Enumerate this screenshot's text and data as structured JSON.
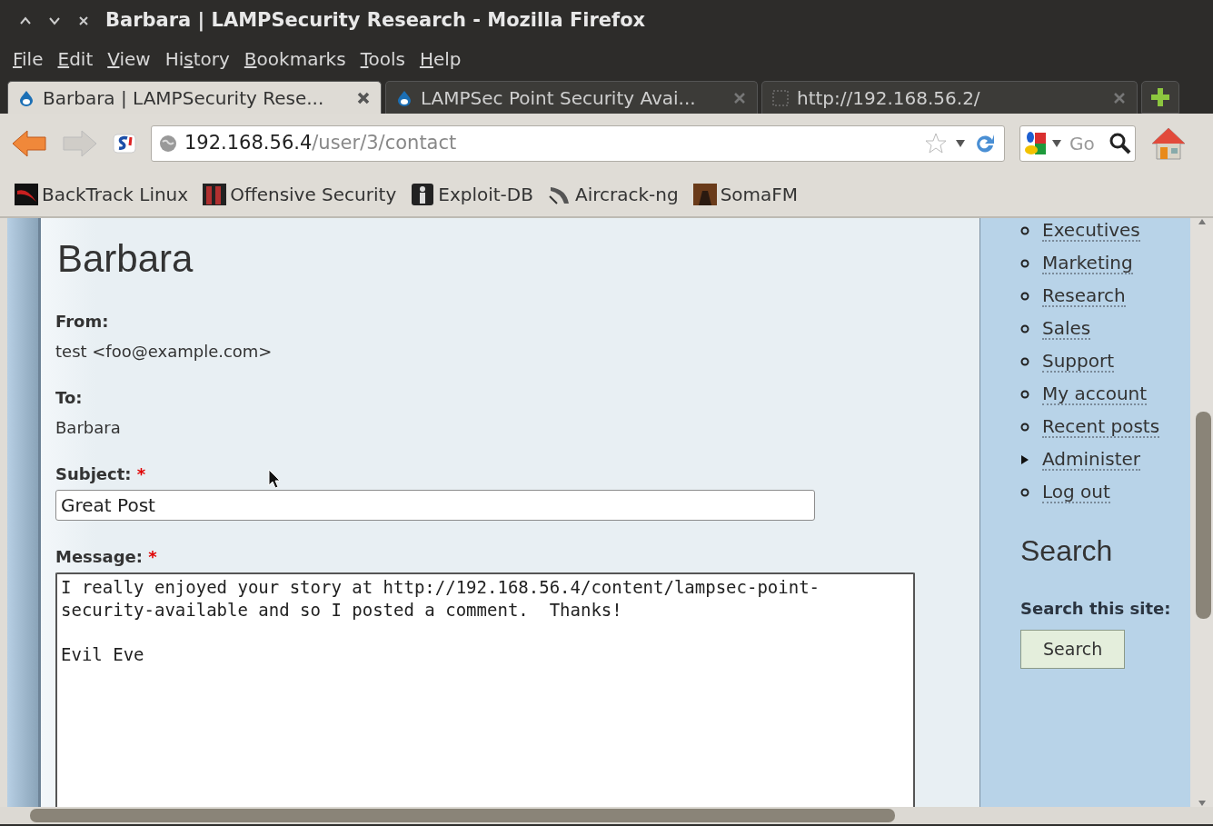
{
  "window": {
    "title": "Barbara | LAMPSecurity Research - Mozilla Firefox"
  },
  "menu": [
    {
      "key": "F",
      "post": "ile"
    },
    {
      "key": "E",
      "post": "dit"
    },
    {
      "key": "V",
      "post": "iew"
    },
    {
      "pre": "Hi",
      "key": "s",
      "post": "tory"
    },
    {
      "key": "B",
      "post": "ookmarks"
    },
    {
      "key": "T",
      "post": "ools"
    },
    {
      "key": "H",
      "post": "elp"
    }
  ],
  "tabs": [
    {
      "label": "Barbara | LAMPSecurity Rese...",
      "selected": true,
      "kind": "drop"
    },
    {
      "label": "LAMPSec Point Security Avai...",
      "selected": false,
      "kind": "drop"
    },
    {
      "label": "http://192.168.56.2/",
      "selected": false,
      "kind": "blank"
    }
  ],
  "address_bar": {
    "host": "192.168.56.4",
    "path": "/user/3/contact"
  },
  "search_box": {
    "value": "Go"
  },
  "bookmarks": [
    {
      "label": "BackTrack Linux",
      "kind": "backtrack"
    },
    {
      "label": "Offensive Security",
      "kind": "offsec"
    },
    {
      "label": "Exploit-DB",
      "kind": "exploit"
    },
    {
      "label": "Aircrack-ng",
      "kind": "aircrack"
    },
    {
      "label": "SomaFM",
      "kind": "soma"
    }
  ],
  "page": {
    "heading": "Barbara",
    "fields": [
      {
        "label": "From:",
        "kind": "text",
        "value": "test <foo@example.com>"
      },
      {
        "label": "To:",
        "kind": "text",
        "value": "Barbara"
      },
      {
        "label": "Subject:",
        "kind": "input",
        "value": "Great Post",
        "required_mark": "*"
      },
      {
        "label": "Message:",
        "kind": "textarea",
        "value": "I really enjoyed your story at http://192.168.56.4/content/lampsec-point-security-available and so I posted a comment.  Thanks!\n\nEvil Eve",
        "required_mark": "*"
      }
    ]
  },
  "sidebar": {
    "menu": [
      {
        "label": "Executives",
        "kind": "leaf"
      },
      {
        "label": "Marketing",
        "kind": "leaf"
      },
      {
        "label": "Research",
        "kind": "leaf"
      },
      {
        "label": "Sales",
        "kind": "leaf"
      },
      {
        "label": "Support",
        "kind": "leaf"
      },
      {
        "label": "My account",
        "kind": "leaf"
      },
      {
        "label": "Recent posts",
        "kind": "leaf"
      },
      {
        "label": "Administer",
        "kind": "collapsed"
      },
      {
        "label": "Log out",
        "kind": "leaf"
      }
    ],
    "search_heading": "Search",
    "search_label": "Search this site:",
    "search_button": "Search"
  }
}
